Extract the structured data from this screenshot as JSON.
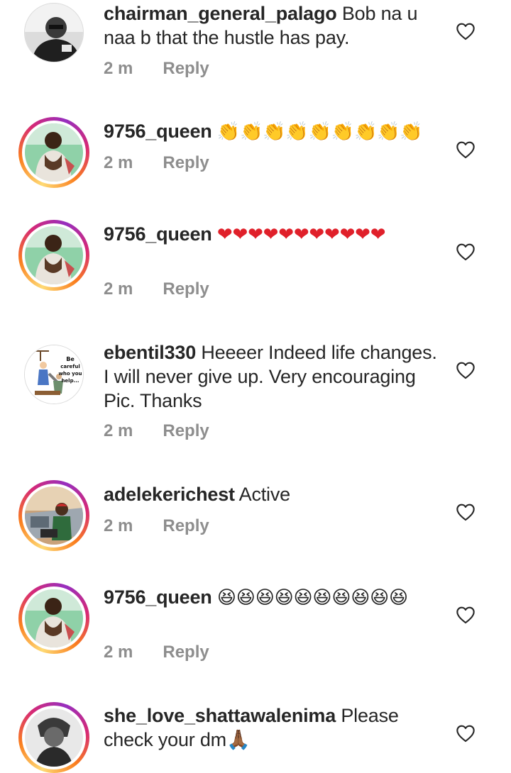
{
  "comments": [
    {
      "username": "chairman_general_palago",
      "text": "Bob na u naa b that the hustle has pay.",
      "time": "2 m",
      "reply_label": "Reply",
      "avatar": "man-in-dark-shirt-avatar",
      "has_story_ring": false
    },
    {
      "username": "9756_queen",
      "text": "👏👏👏👏👏👏👏👏👏",
      "time": "2 m",
      "reply_label": "Reply",
      "avatar": "woman-green-background-avatar",
      "has_story_ring": true
    },
    {
      "username": "9756_queen",
      "text": "❤❤❤❤❤❤❤❤❤❤❤",
      "time": "2 m",
      "reply_label": "Reply",
      "avatar": "woman-green-background-avatar",
      "has_story_ring": true
    },
    {
      "username": "ebentil330",
      "text": "Heeeer Indeed life changes. I will never give up. Very encouraging Pic. Thanks",
      "time": "2 m",
      "reply_label": "Reply",
      "avatar": "be-careful-who-you-help-cartoon-avatar",
      "avatar_caption": "Be careful who you help...",
      "has_story_ring": false
    },
    {
      "username": "adelekerichest",
      "text": "Active",
      "time": "2 m",
      "reply_label": "Reply",
      "avatar": "man-with-car-avatar",
      "has_story_ring": true
    },
    {
      "username": "9756_queen",
      "text": "😆😆😆😆😆😆😆😆😆😆",
      "time": "2 m",
      "reply_label": "Reply",
      "avatar": "woman-green-background-avatar",
      "has_story_ring": true
    },
    {
      "username": "she_love_shattawalenima",
      "text": "Please check your dm🙏🏾",
      "avatar": "woman-black-white-avatar",
      "has_story_ring": true
    }
  ],
  "colors": {
    "text": "#262626",
    "meta": "#8e8e8e",
    "heart_outline": "#262626"
  }
}
